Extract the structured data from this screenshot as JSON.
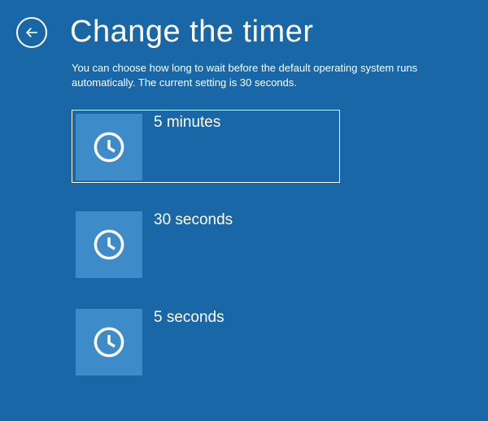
{
  "header": {
    "title": "Change the timer"
  },
  "description": "You can choose how long to wait before the default operating system runs automatically. The current setting is 30 seconds.",
  "options": [
    {
      "label": "5 minutes",
      "selected": true
    },
    {
      "label": "30 seconds",
      "selected": false
    },
    {
      "label": "5 seconds",
      "selected": false
    }
  ],
  "colors": {
    "background": "#1a67a8",
    "tile": "#3e8bc9",
    "foreground": "#ffffff"
  }
}
